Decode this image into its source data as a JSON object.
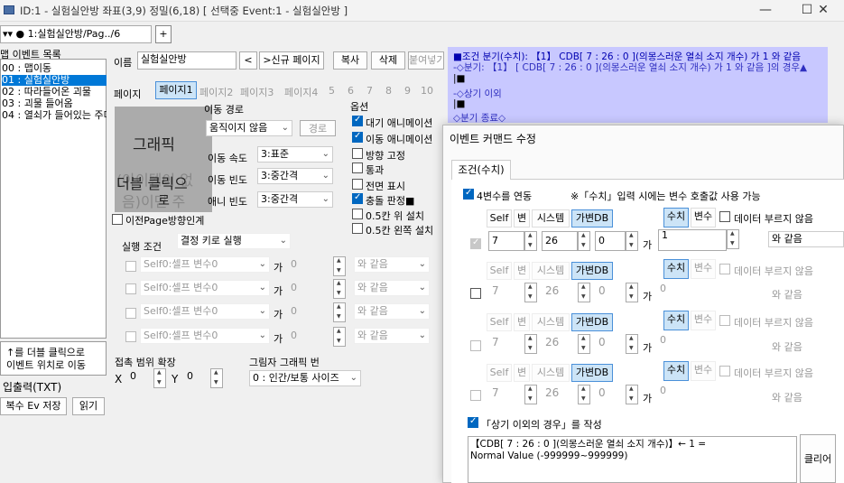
{
  "window": {
    "title": "ID:1 - 실험실안방 좌표(3,9) 정밀(6,18) [ 선택중 Event:1 - 실험실안방 ]",
    "minimize": "—",
    "maximize": "☐",
    "close": "✕"
  },
  "tabs": {
    "active": "▾▾ ● 1:실험실안방/Pag../6",
    "add": "+"
  },
  "left": {
    "header": "맵 이벤트 목록",
    "items": [
      "00 : 맵이동",
      "01 : 실험실안방",
      "02 : 따라들어온 괴물",
      "03 : 괴물 들어옴",
      "04 : 열쇠가 들어있는 주머"
    ],
    "hint1": "↑를 더블 클릭으로",
    "hint2": "이벤트 위치로 이동",
    "io": "입출력(TXT)",
    "copy": "복수 Ev 저장",
    "read": "읽기"
  },
  "editor": {
    "name_label": "이름",
    "name_value": "실험실안방",
    "prev": "<",
    ">new": "",
    "new_page": ">신규 페이지",
    "copy": "복사",
    "delete": "삭제",
    "paste": "붙여넣기",
    "page_label": "페이지",
    "pages": [
      "페이지1",
      "페이지2",
      "페이지3",
      "페이지4",
      "5",
      "6",
      "7",
      "8",
      "9",
      "10"
    ],
    "graphic": "그래픽",
    "graphic_hint1": "더블 클릭으",
    "graphic_hint2": "로",
    "graphic_overlay1": "(아이템이 없",
    "graphic_overlay2": "음)이면 주",
    "move_route_label": "이동 경로",
    "move_route_value": "움직이지 않음",
    "route_btn": "경로",
    "speed_label": "이동 속도",
    "speed_value": "3:표준",
    "freq_label": "이동 빈도",
    "freq_value": "3:중간격",
    "anim_label": "애니 빈도",
    "anim_value": "3:중간격",
    "options_label": "옵션",
    "options": [
      "대기 애니메이션",
      "이동 애니메이션",
      "방향 고정",
      "통과",
      "전면 표시",
      "충돌 판정■",
      "0.5칸 위 설치",
      "0.5칸 왼쪽 설치"
    ],
    "prev_dir": "이전Page방향인계",
    "trigger_label": "실행 조건",
    "trigger_value": "결정 키로 실행",
    "cond_rows": [
      {
        "var": "Self0:셀프 변수0",
        "ga": "가",
        "val": "0",
        "op": "와 같음"
      },
      {
        "var": "Self0:셀프 변수0",
        "ga": "가",
        "val": "0",
        "op": "와 같음"
      },
      {
        "var": "Self0:셀프 변수0",
        "ga": "가",
        "val": "0",
        "op": "와 같음"
      },
      {
        "var": "Self0:셀프 변수0",
        "ga": "가",
        "val": "0",
        "op": "와 같음"
      }
    ],
    "contact_label": "접촉 범위 확장",
    "x_label": "X",
    "x_value": "0",
    "y_label": "Y",
    "y_value": "0",
    "shadow_label": "그림자 그래픽 번",
    "shadow_value": "0 : 인간/보통 사이즈"
  },
  "commands": [
    "■조건 분기(수치): 【1】 CDB[ 7 : 26 : 0 ](의몽스러운 열쇠 소지 개수)  가  1 와 같음",
    "-◇분기: 【1】 [ CDB[ 7 : 26 : 0 ](의몽스러운 열쇠 소지 개수)  가  1 와 같음 ]의 경우▲",
    "|■",
    "-◇상기 이외",
    "|■",
    "◇분기 종료◇"
  ],
  "dialog": {
    "title": "이벤트 커맨드 수정",
    "tab": "조건(수치)",
    "link_label": "4변수를 연동",
    "note": "※「수치」입력 시에는 변수 호출값 사용 가능",
    "rows": [
      {
        "self": "Self",
        "var": "변",
        "sys": "시스템",
        "db": "가변DB",
        "a": "7",
        "b": "26",
        "c": "0",
        "ga": "가",
        "num": "수치",
        "varb": "변수",
        "nodata": "데이터 부르지 않음",
        "val": "1",
        "op": "와 같음"
      },
      {
        "self": "Self",
        "var": "변",
        "sys": "시스템",
        "db": "가변DB",
        "a": "7",
        "b": "26",
        "c": "0",
        "ga": "가",
        "num": "수치",
        "varb": "변수",
        "nodata": "데이터 부르지 않음",
        "val": "0",
        "op": "와 같음"
      },
      {
        "self": "Self",
        "var": "변",
        "sys": "시스템",
        "db": "가변DB",
        "a": "7",
        "b": "26",
        "c": "0",
        "ga": "가",
        "num": "수치",
        "varb": "변수",
        "nodata": "데이터 부르지 않음",
        "val": "0",
        "op": "와 같음"
      },
      {
        "self": "Self",
        "var": "변",
        "sys": "시스템",
        "db": "가변DB",
        "a": "7",
        "b": "26",
        "c": "0",
        "ga": "가",
        "num": "수치",
        "varb": "변수",
        "nodata": "데이터 부르지 않음",
        "val": "0",
        "op": "와 같음"
      }
    ],
    "else_label": "「상기 이외의 경우」를 작성",
    "preview": "【CDB[ 7 : 26 : 0 ](의몽스러운 열쇠 소지 개수)】← 1 =\nNormal Value (-999999~999999)",
    "clear": "클리어"
  }
}
